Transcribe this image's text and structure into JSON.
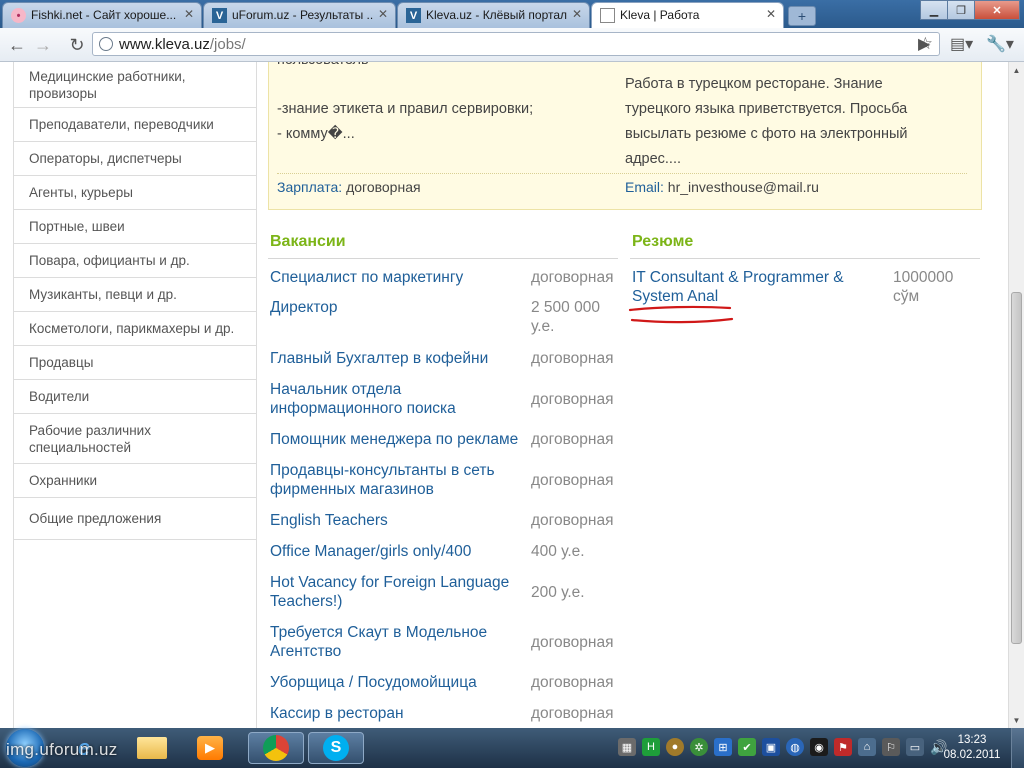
{
  "browser": {
    "tabs": [
      {
        "title": "Fishki.net - Сайт хороше...",
        "icon": "pig-favicon-icon"
      },
      {
        "title": "uForum.uz - Результаты ...",
        "icon": "v-favicon-icon"
      },
      {
        "title": "Kleva.uz - Клёвый портал...",
        "icon": "v-favicon-icon"
      },
      {
        "title": "Kleva | Работа",
        "icon": "page-icon"
      }
    ],
    "active_tab": 3,
    "url_host": "www.kleva.uz",
    "url_path": "/jobs/"
  },
  "sidebar": {
    "categories": [
      "Медицинские работники, провизоры",
      "Преподаватели, переводчики",
      "Операторы, диспетчеры",
      "Агенты, курьеры",
      "Портные, швеи",
      "Повара, официанты и др.",
      "Музиканты, певци и др.",
      "Косметологи, парикмахеры и др.",
      "Продавцы",
      "Водители",
      "Рабочие различних специальностей",
      "Охранники",
      "Общие предложения"
    ]
  },
  "ad_box": {
    "left_top_fragment": "пользователь",
    "left_lines": [
      "-знание этикета и правил сервировки;",
      "- комму�..."
    ],
    "right_lines": [
      "Работа в турецком ресторане. Знание",
      "турецкого языка приветствуется. Просьба",
      "высылать резюме с фото на электронный",
      "адрес...."
    ],
    "salary_label": "Зарплата:",
    "salary_value": "договорная",
    "email_label": "Email:",
    "email_value": "hr_investhouse@mail.ru"
  },
  "vacancies": {
    "heading": "Вакансии",
    "items": [
      {
        "title_lines": [
          "Специалист по маркетингу"
        ],
        "salary_lines": [
          "договорная"
        ]
      },
      {
        "title_lines": [
          "Директор"
        ],
        "salary_lines": [
          "2 500 000",
          "у.е."
        ]
      },
      {
        "title_lines": [
          "Главный Бухгалтер в кофейни"
        ],
        "salary_lines": [
          "договорная"
        ]
      },
      {
        "title_lines": [
          "Начальник отдела",
          "информационного поиска"
        ],
        "salary_lines": [
          "договорная"
        ]
      },
      {
        "title_lines": [
          "Помощник менеджера по рекламе"
        ],
        "salary_lines": [
          "договорная"
        ]
      },
      {
        "title_lines": [
          "Продавцы-консультанты в сеть",
          "фирменных магазинов"
        ],
        "salary_lines": [
          "договорная"
        ]
      },
      {
        "title_lines": [
          "English Teachers"
        ],
        "salary_lines": [
          "договорная"
        ]
      },
      {
        "title_lines": [
          "Office Manager/girls only/400"
        ],
        "salary_lines": [
          "400 у.е."
        ]
      },
      {
        "title_lines": [
          "Hot Vacancy for Foreign Language",
          "Teachers!)"
        ],
        "salary_lines": [
          "200 у.е."
        ]
      },
      {
        "title_lines": [
          "Требуется Скаут в Модельное",
          "Агентство"
        ],
        "salary_lines": [
          "договорная"
        ]
      },
      {
        "title_lines": [
          "Уборщица / Посудомойщица"
        ],
        "salary_lines": [
          "договорная"
        ]
      },
      {
        "title_lines": [
          "Кассир в ресторан"
        ],
        "salary_lines": [
          "договорная"
        ]
      }
    ]
  },
  "resumes": {
    "heading": "Резюме",
    "items": [
      {
        "title_lines": [
          "IT Consultant & Programmer &",
          "System Anal"
        ],
        "salary_lines": [
          "1000000",
          "сўм"
        ]
      }
    ]
  },
  "taskbar": {
    "watermark": "img.uforum.uz",
    "time": "13:23",
    "date": "08.02.2011"
  },
  "colors": {
    "link": "#1f5f99",
    "section_heading": "#7cb518",
    "ad_background": "#fffbe3",
    "annotation": "#d01818"
  }
}
